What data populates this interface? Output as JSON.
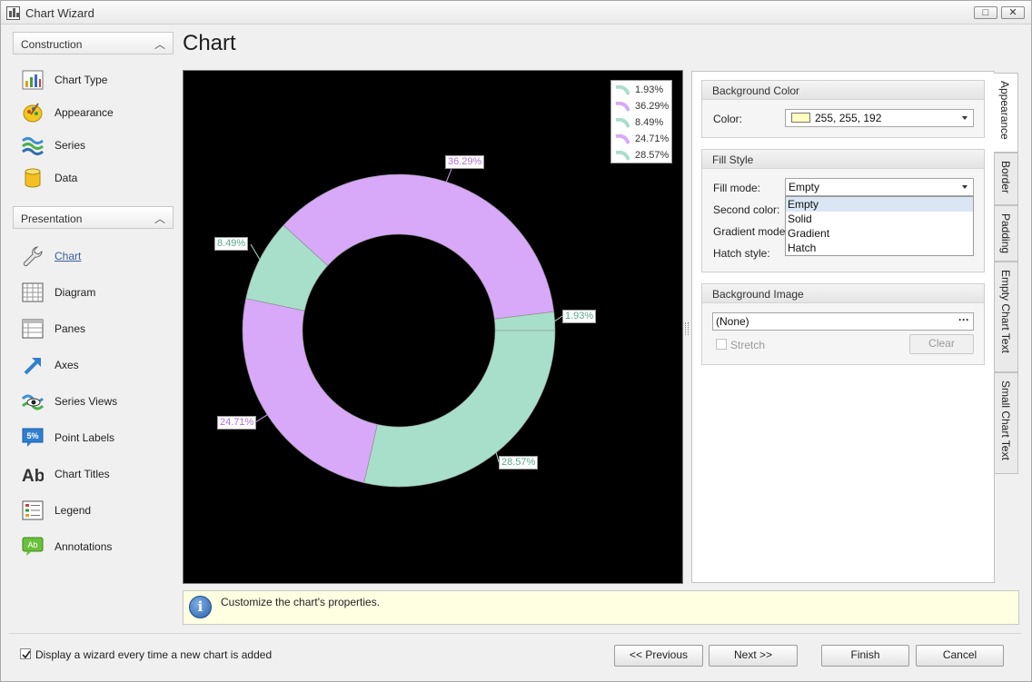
{
  "window": {
    "title": "Chart Wizard",
    "restore_glyph": "□",
    "close_glyph": "✕"
  },
  "nav": {
    "construction": {
      "header": "Construction",
      "items": [
        {
          "label": "Chart Type",
          "icon": "chart-type-icon"
        },
        {
          "label": "Appearance",
          "icon": "appearance-icon"
        },
        {
          "label": "Series",
          "icon": "series-icon"
        },
        {
          "label": "Data",
          "icon": "data-icon"
        }
      ]
    },
    "presentation": {
      "header": "Presentation",
      "items": [
        {
          "label": "Chart",
          "icon": "wrench-icon",
          "active": true
        },
        {
          "label": "Diagram",
          "icon": "diagram-icon"
        },
        {
          "label": "Panes",
          "icon": "panes-icon"
        },
        {
          "label": "Axes",
          "icon": "axes-icon"
        },
        {
          "label": "Series Views",
          "icon": "series-views-icon"
        },
        {
          "label": "Point Labels",
          "icon": "point-labels-icon",
          "glyph": "5%"
        },
        {
          "label": "Chart Titles",
          "icon": "chart-titles-icon",
          "glyph": "Ab"
        },
        {
          "label": "Legend",
          "icon": "legend-icon"
        },
        {
          "label": "Annotations",
          "icon": "annotations-icon",
          "glyph": "Ab"
        }
      ]
    }
  },
  "page_title": "Chart",
  "chart_data": {
    "type": "pie",
    "variant": "doughnut",
    "background": "#000000",
    "slices": [
      {
        "label": "1.93%",
        "value": 1.93,
        "color": "#a8dfca"
      },
      {
        "label": "36.29%",
        "value": 36.29,
        "color": "#d8a8f9"
      },
      {
        "label": "8.49%",
        "value": 8.49,
        "color": "#a8dfca"
      },
      {
        "label": "24.71%",
        "value": 24.71,
        "color": "#d8a8f9"
      },
      {
        "label": "28.57%",
        "value": 28.57,
        "color": "#a8dfca"
      }
    ],
    "legend": {
      "position": "top-right",
      "entries": [
        "1.93%",
        "36.29%",
        "8.49%",
        "24.71%",
        "28.57%"
      ]
    }
  },
  "panel": {
    "background_color": {
      "header": "Background Color",
      "color_label": "Color:",
      "color_value": "255, 255, 192",
      "swatch": "#ffffc0"
    },
    "fill_style": {
      "header": "Fill Style",
      "fill_mode_label": "Fill mode:",
      "fill_mode_value": "Empty",
      "second_color_label": "Second color:",
      "gradient_mode_label": "Gradient mode:",
      "hatch_style_label": "Hatch style:",
      "options": [
        "Empty",
        "Solid",
        "Gradient",
        "Hatch"
      ]
    },
    "background_image": {
      "header": "Background Image",
      "value": "(None)",
      "browse": "···",
      "stretch_label": "Stretch",
      "clear_label": "Clear"
    }
  },
  "tabs": [
    "Appearance",
    "Border",
    "Padding",
    "Empty Chart Text",
    "Small Chart Text"
  ],
  "info": {
    "text": "Customize the chart's properties.",
    "glyph": "i"
  },
  "footer": {
    "checkbox_label": "Display a wizard every time a new chart is added",
    "checked": true,
    "previous": "<< Previous",
    "next": "Next >>",
    "finish": "Finish",
    "cancel": "Cancel"
  }
}
